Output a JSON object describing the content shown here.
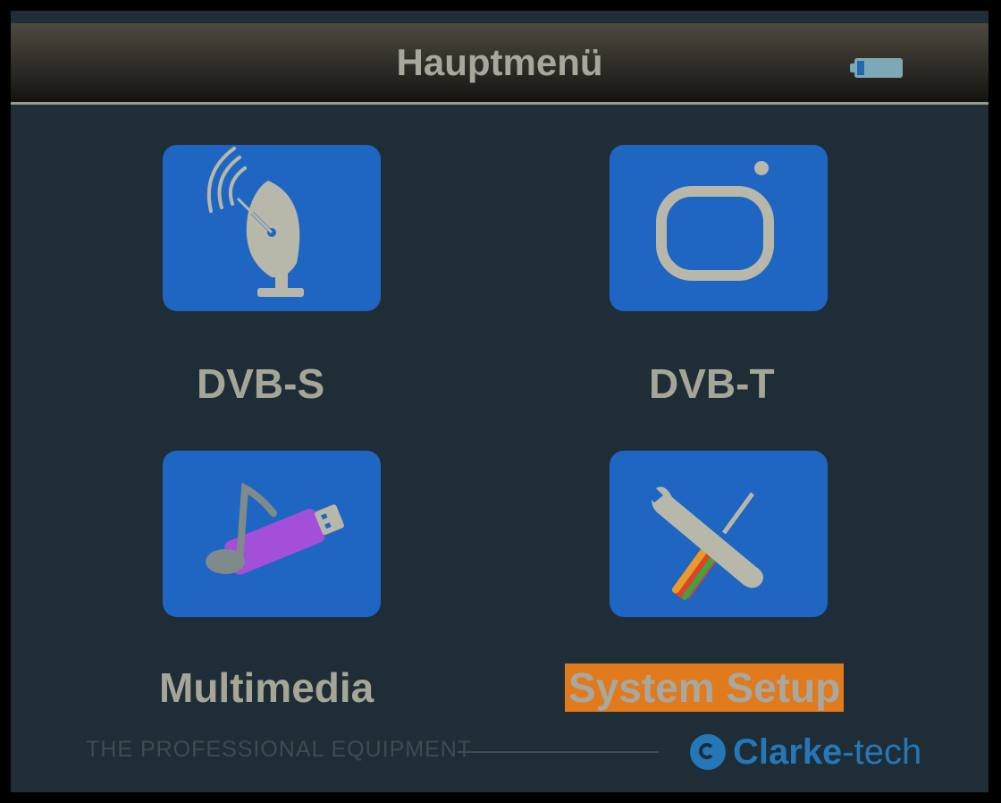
{
  "header": {
    "title": "Hauptmenü",
    "battery_icon": "battery-icon"
  },
  "menu": {
    "items": [
      {
        "label": "DVB-S",
        "icon": "satellite-dish-icon",
        "selected": false
      },
      {
        "label": "DVB-T",
        "icon": "tv-screen-icon",
        "selected": false
      },
      {
        "label": "Multimedia",
        "icon": "music-usb-icon",
        "selected": false
      },
      {
        "label": "System Setup",
        "icon": "tools-icon",
        "selected": true
      }
    ]
  },
  "footer": {
    "tagline": "THE PROFESSIONAL EQUIPMENT",
    "brand_strong": "Clarke",
    "brand_light": "-tech"
  },
  "colors": {
    "tile": "#1f66c2",
    "selected_highlight": "#e07a1c",
    "background": "#1f2d37",
    "brand": "#2477b8"
  }
}
